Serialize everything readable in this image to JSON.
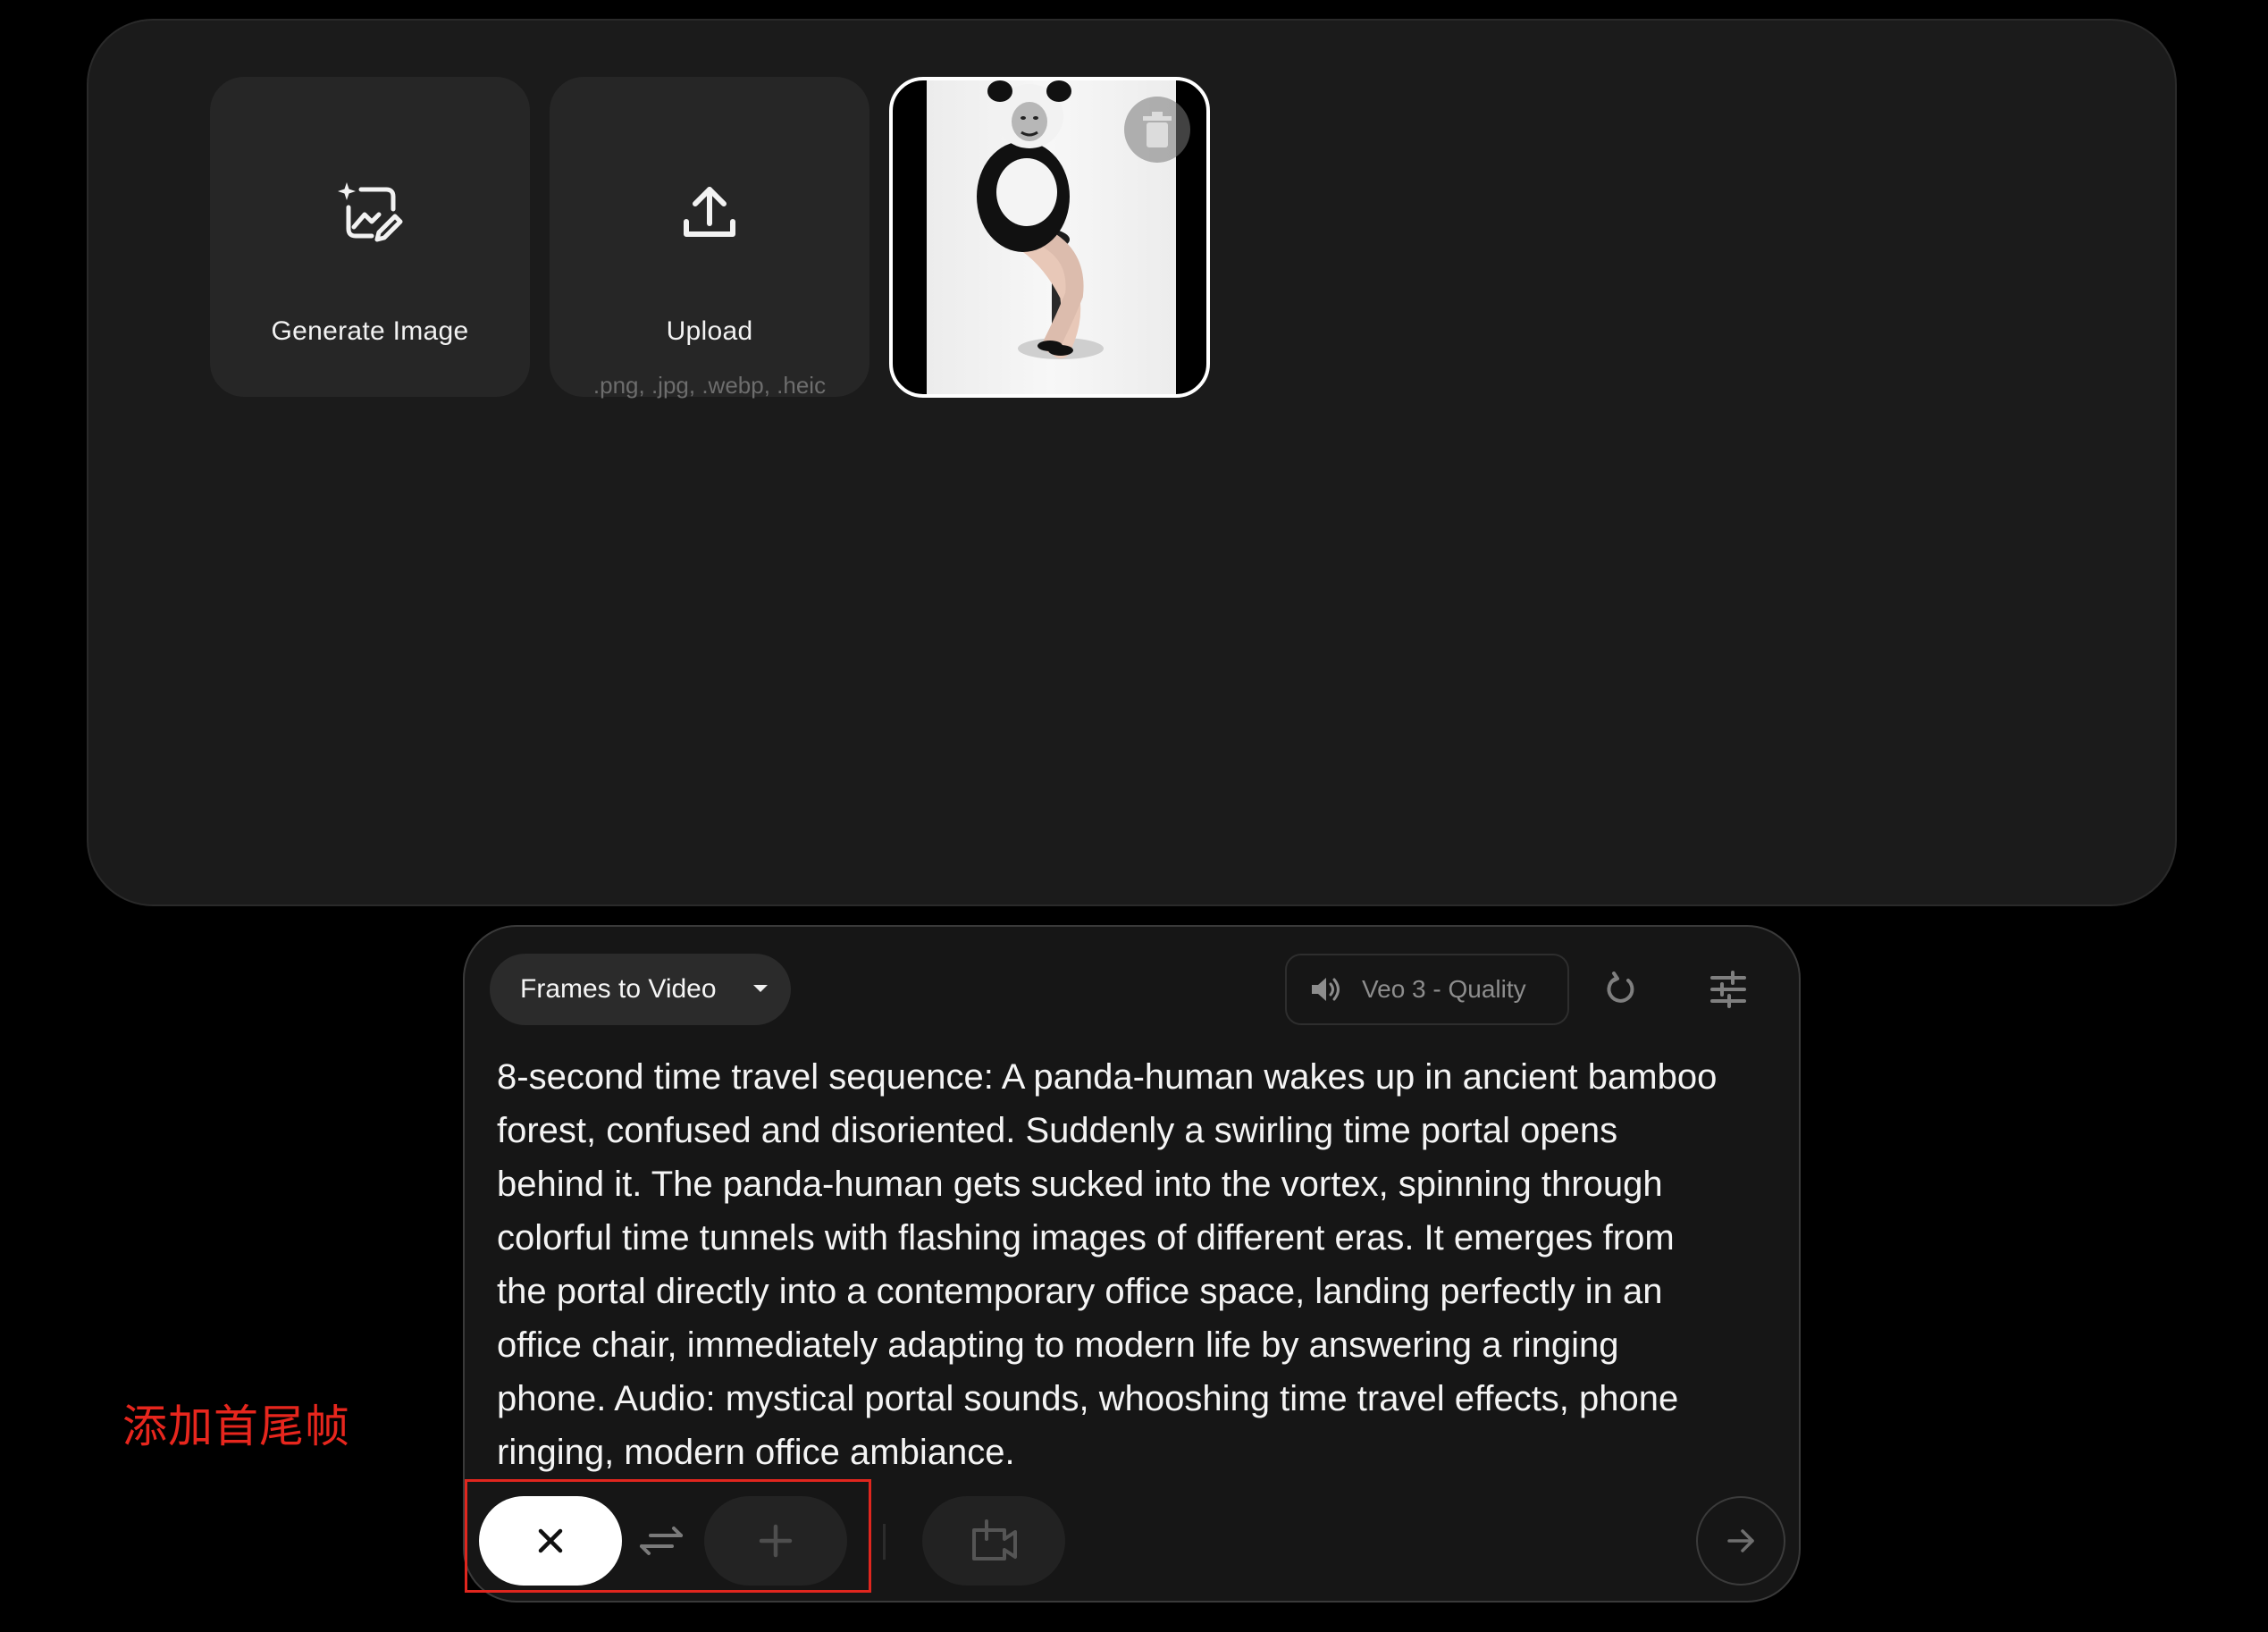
{
  "media_panel": {
    "generate_tile": {
      "label": "Generate Image",
      "icon": "image-sparkle-edit-icon"
    },
    "upload_tile": {
      "label": "Upload",
      "formats": ".png, .jpg, .webp, .heic",
      "icon": "upload-icon"
    },
    "selected_image": {
      "alt": "panda-human sitting on bar stool",
      "delete_icon": "trash-icon"
    }
  },
  "composer": {
    "mode_dropdown": {
      "label": "Frames to Video",
      "icon": "caret-down-icon"
    },
    "model_chip": {
      "label": "Veo 3 - Quality",
      "icon": "volume-icon"
    },
    "refresh_icon": "refresh-icon",
    "settings_icon": "tune-icon",
    "prompt": "8-second time travel sequence: A panda-human wakes up in ancient bamboo\nforest, confused and disoriented. Suddenly a swirling time portal opens\nbehind it. The panda-human gets sucked into the vortex, spinning through\ncolorful time tunnels with flashing images of different eras. It emerges from\nthe portal directly into a contemporary office space, landing perfectly in an\noffice chair, immediately adapting to modern life by answering a ringing\nphone. Audio: mystical portal sounds, whooshing time travel effects, phone\nringing, modern office ambiance.",
    "frame_controls": {
      "first_frame_icon": "close-icon",
      "swap_icon": "swap-arrows-icon",
      "last_frame_icon": "plus-icon"
    },
    "add_scene_icon": "video-add-icon",
    "send_icon": "arrow-right-icon"
  },
  "annotation": {
    "text": "添加首尾帧",
    "color": "#e0261e"
  },
  "colors": {
    "background": "#000000",
    "panel": "#1b1b1b",
    "accent_white": "#ffffff"
  }
}
